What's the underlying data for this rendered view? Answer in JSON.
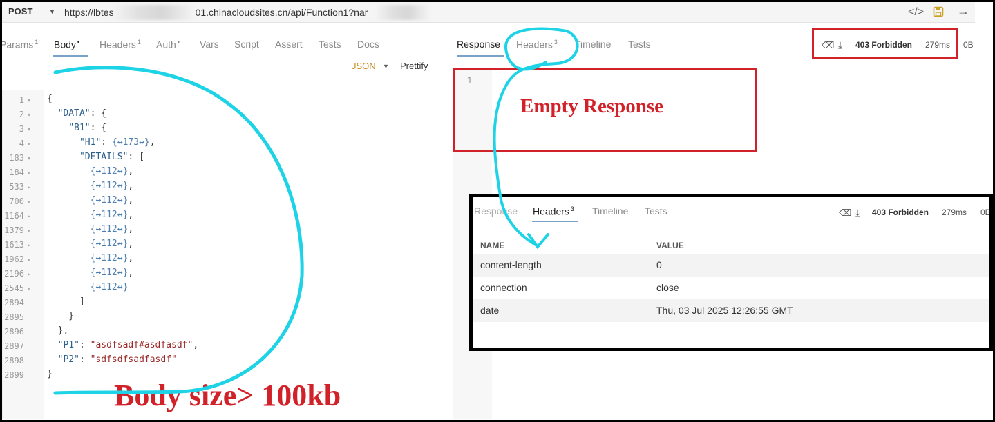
{
  "request": {
    "method": "POST",
    "url_visible": "https://lbtes",
    "url_visible_end": "01.chinacloudsites.cn/api/Function1?nar",
    "tabs": [
      {
        "label": "Params",
        "sup": "1"
      },
      {
        "label": "Body",
        "sup": "•"
      },
      {
        "label": "Headers",
        "sup": "1"
      },
      {
        "label": "Auth",
        "sup": "•"
      },
      {
        "label": "Vars",
        "sup": ""
      },
      {
        "label": "Script",
        "sup": ""
      },
      {
        "label": "Assert",
        "sup": ""
      },
      {
        "label": "Tests",
        "sup": ""
      },
      {
        "label": "Docs",
        "sup": ""
      }
    ],
    "body_mode": "JSON",
    "prettify_label": "Prettify"
  },
  "editor": {
    "lines": [
      {
        "n": "1",
        "fold": "▾"
      },
      {
        "n": "2",
        "fold": "▾"
      },
      {
        "n": "3",
        "fold": "▾"
      },
      {
        "n": "4",
        "fold": "▸"
      },
      {
        "n": "183",
        "fold": "▾"
      },
      {
        "n": "184",
        "fold": "▸"
      },
      {
        "n": "533",
        "fold": "▸"
      },
      {
        "n": "700",
        "fold": "▸"
      },
      {
        "n": "1164",
        "fold": "▸"
      },
      {
        "n": "1379",
        "fold": "▸"
      },
      {
        "n": "1613",
        "fold": "▸"
      },
      {
        "n": "1962",
        "fold": "▸"
      },
      {
        "n": "2196",
        "fold": "▸"
      },
      {
        "n": "2545",
        "fold": "▸"
      },
      {
        "n": "2894",
        "fold": ""
      },
      {
        "n": "2895",
        "fold": ""
      },
      {
        "n": "2896",
        "fold": ""
      },
      {
        "n": "2897",
        "fold": ""
      },
      {
        "n": "2898",
        "fold": ""
      },
      {
        "n": "2899",
        "fold": ""
      }
    ],
    "code": {
      "l1": "{",
      "data_key": "\"DATA\"",
      "b1_key": "\"B1\"",
      "h1_key": "\"H1\"",
      "h1_fold": "{↔173↔}",
      "details_key": "\"DETAILS\"",
      "detail_fold": "{↔112↔}",
      "p1_key": "\"P1\"",
      "p1_val": "\"asdfsadf#asdfasdf\"",
      "p2_key": "\"P2\"",
      "p2_val": "\"sdfsdfsadfasdf\""
    }
  },
  "response": {
    "tabs": [
      {
        "label": "Response",
        "sup": ""
      },
      {
        "label": "Headers",
        "sup": "3"
      },
      {
        "label": "Timeline",
        "sup": ""
      },
      {
        "label": "Tests",
        "sup": ""
      }
    ],
    "status": "403 Forbidden",
    "time": "279ms",
    "size": "0B",
    "line_number": "1"
  },
  "annotations": {
    "empty_response": "Empty Response",
    "body_size": "Body size> 100kb",
    "red_color": "#d1222a",
    "cyan_color": "#1ed3e6"
  },
  "inset": {
    "tabs": [
      {
        "label": "Response",
        "sup": ""
      },
      {
        "label": "Headers",
        "sup": "3"
      },
      {
        "label": "Timeline",
        "sup": ""
      },
      {
        "label": "Tests",
        "sup": ""
      }
    ],
    "status": "403 Forbidden",
    "time": "279ms",
    "size": "0B",
    "col_name": "NAME",
    "col_value": "VALUE",
    "rows": [
      {
        "name": "content-length",
        "value": "0"
      },
      {
        "name": "connection",
        "value": "close"
      },
      {
        "name": "date",
        "value": "Thu, 03 Jul 2025 12:26:55 GMT"
      }
    ]
  }
}
